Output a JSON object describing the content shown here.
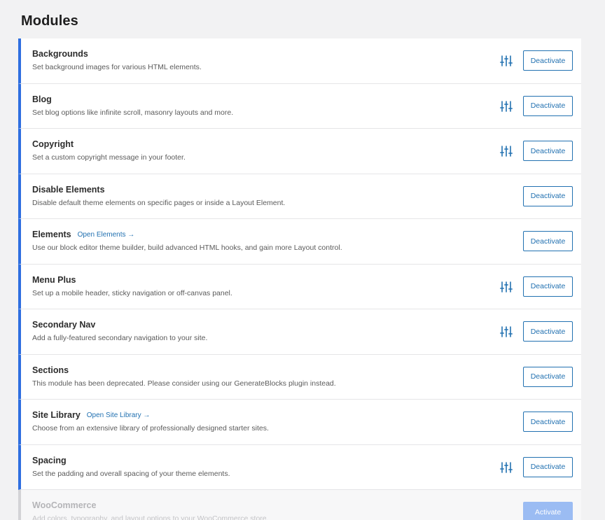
{
  "page": {
    "title": "Modules"
  },
  "modules": [
    {
      "name": "Backgrounds",
      "description": "Set background images for various HTML elements.",
      "link": "",
      "has_settings": true,
      "button_label": "Deactivate",
      "active": true
    },
    {
      "name": "Blog",
      "description": "Set blog options like infinite scroll, masonry layouts and more.",
      "link": "",
      "has_settings": true,
      "button_label": "Deactivate",
      "active": true
    },
    {
      "name": "Copyright",
      "description": "Set a custom copyright message in your footer.",
      "link": "",
      "has_settings": true,
      "button_label": "Deactivate",
      "active": true
    },
    {
      "name": "Disable Elements",
      "description": "Disable default theme elements on specific pages or inside a Layout Element.",
      "link": "",
      "has_settings": false,
      "button_label": "Deactivate",
      "active": true
    },
    {
      "name": "Elements",
      "description": "Use our block editor theme builder, build advanced HTML hooks, and gain more Layout control.",
      "link": "Open Elements →",
      "has_settings": false,
      "button_label": "Deactivate",
      "active": true
    },
    {
      "name": "Menu Plus",
      "description": "Set up a mobile header, sticky navigation or off-canvas panel.",
      "link": "",
      "has_settings": true,
      "button_label": "Deactivate",
      "active": true
    },
    {
      "name": "Secondary Nav",
      "description": "Add a fully-featured secondary navigation to your site.",
      "link": "",
      "has_settings": true,
      "button_label": "Deactivate",
      "active": true
    },
    {
      "name": "Sections",
      "description": "This module has been deprecated. Please consider using our GenerateBlocks plugin instead.",
      "link": "",
      "has_settings": false,
      "button_label": "Deactivate",
      "active": true
    },
    {
      "name": "Site Library",
      "description": "Choose from an extensive library of professionally designed starter sites.",
      "link": "Open Site Library →",
      "has_settings": false,
      "button_label": "Deactivate",
      "active": true
    },
    {
      "name": "Spacing",
      "description": "Set the padding and overall spacing of your theme elements.",
      "link": "",
      "has_settings": true,
      "button_label": "Deactivate",
      "active": true
    },
    {
      "name": "WooCommerce",
      "description": "Add colors, typography, and layout options to your WooCommerce store.",
      "link": "",
      "has_settings": false,
      "button_label": "Activate",
      "active": false
    }
  ],
  "icons": {
    "settings": "sliders-icon"
  },
  "colors": {
    "accent": "#2271b1",
    "active_border": "#2f6fe0",
    "inactive_button": "#9bbcf3"
  }
}
